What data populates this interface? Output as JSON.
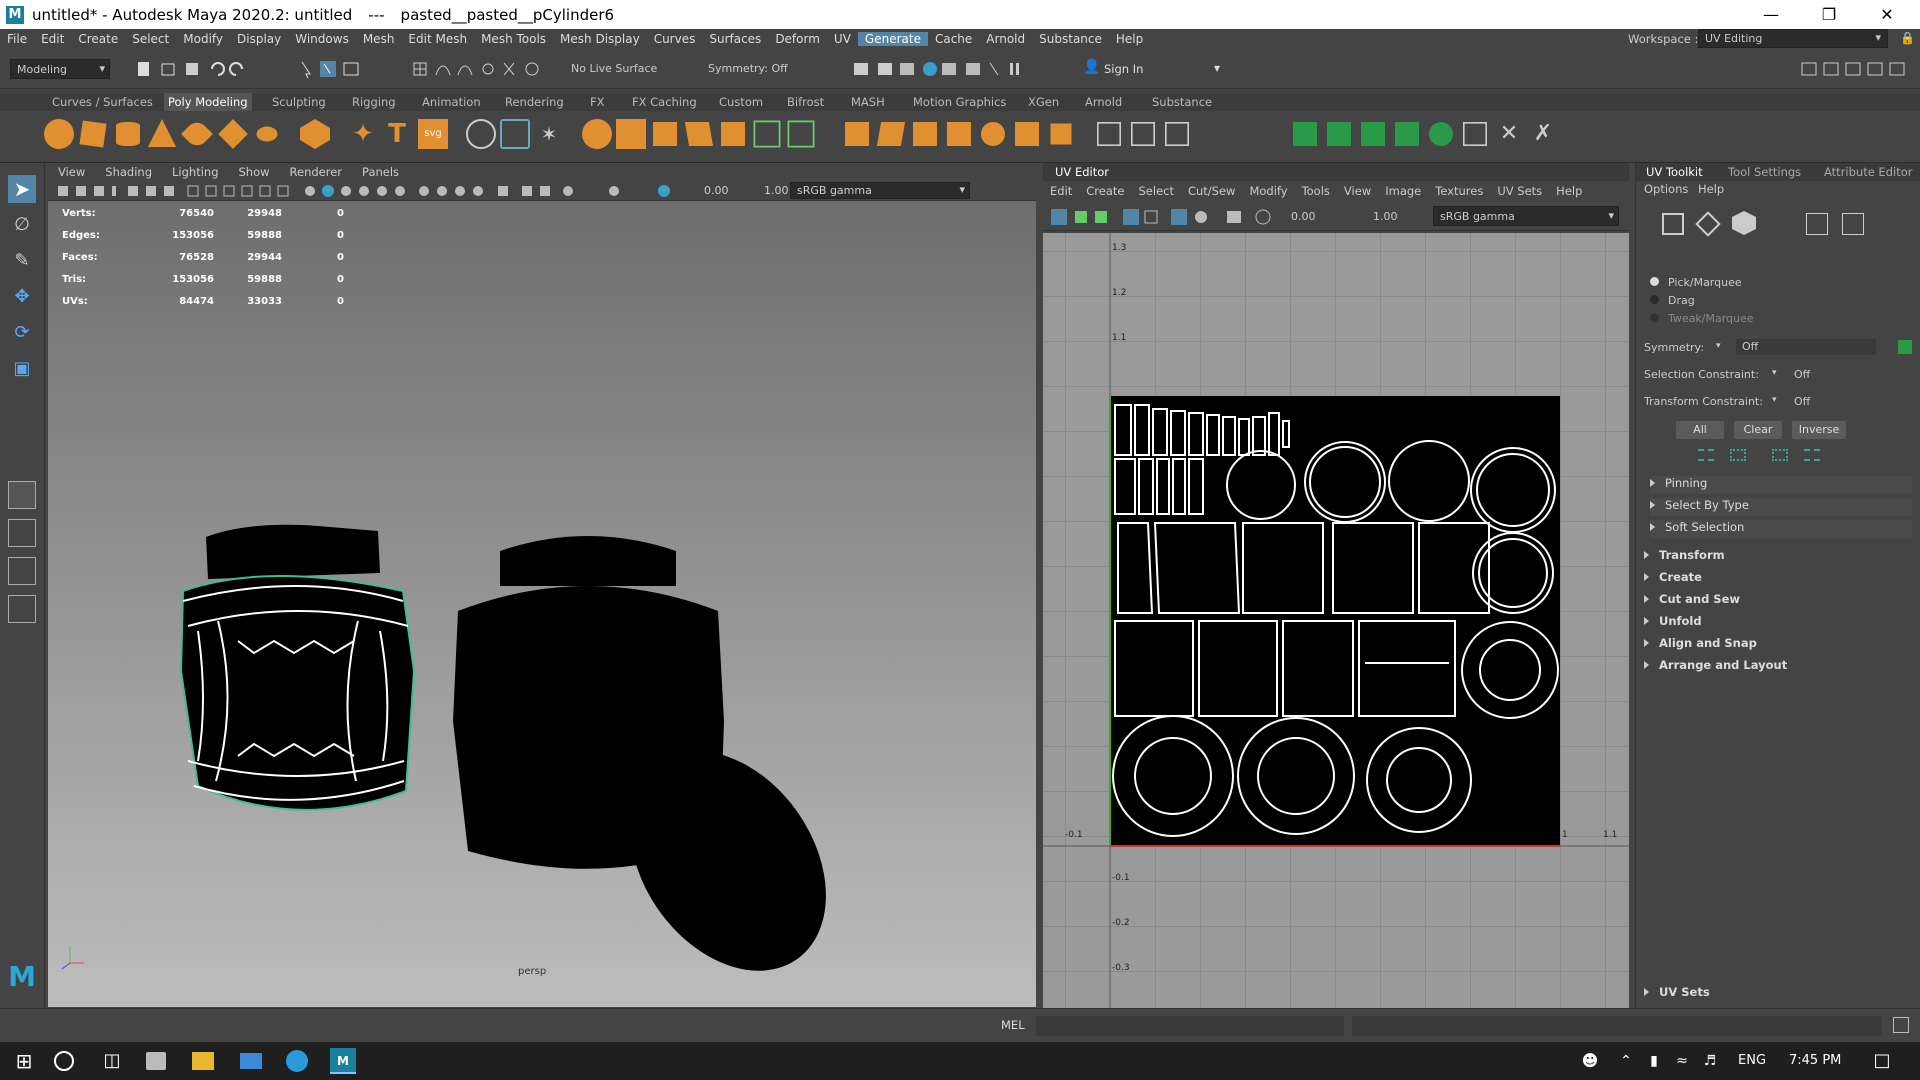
{
  "title": {
    "app_title": "untitled* - Autodesk Maya 2020.2: untitled",
    "separator": "---",
    "object_name": "pasted__pasted__pCylinder6",
    "minimize_icon": "minimize-icon",
    "restore_icon": "restore-icon",
    "close_icon": "close-icon"
  },
  "menubar": {
    "items": [
      "File",
      "Edit",
      "Create",
      "Select",
      "Modify",
      "Display",
      "Windows",
      "Mesh",
      "Edit Mesh",
      "Mesh Tools",
      "Mesh Display",
      "Curves",
      "Surfaces",
      "Deform",
      "UV",
      "Generate",
      "Cache",
      "Arnold",
      "Substance",
      "Help"
    ],
    "active": "Generate",
    "workspace_label": "Workspace :",
    "workspace_value": "UV Editing"
  },
  "statusline": {
    "menuset": "Modeling",
    "live_surface": "No Live Surface",
    "symmetry": "Symmetry: Off",
    "sign_in": "Sign In"
  },
  "shelf": {
    "tabs": [
      "Curves / Surfaces",
      "Poly Modeling",
      "Sculpting",
      "Rigging",
      "Animation",
      "Rendering",
      "FX",
      "FX Caching",
      "Custom",
      "Bifrost",
      "MASH",
      "Motion Graphics",
      "XGen",
      "Arnold",
      "Substance"
    ],
    "active": "Poly Modeling",
    "svg_label": "svg"
  },
  "viewport": {
    "menus": [
      "View",
      "Shading",
      "Lighting",
      "Show",
      "Renderer",
      "Panels"
    ],
    "exposure": "0.00",
    "gamma": "1.00",
    "colorspace": "sRGB gamma",
    "camera": "persp",
    "hud": [
      {
        "label": "Verts:",
        "a": "76540",
        "b": "29948",
        "c": "0"
      },
      {
        "label": "Edges:",
        "a": "153056",
        "b": "59888",
        "c": "0"
      },
      {
        "label": "Faces:",
        "a": "76528",
        "b": "29944",
        "c": "0"
      },
      {
        "label": "Tris:",
        "a": "153056",
        "b": "59888",
        "c": "0"
      },
      {
        "label": "UVs:",
        "a": "84474",
        "b": "33033",
        "c": "0"
      }
    ]
  },
  "uv_editor": {
    "tab": "UV Editor",
    "menus": [
      "Edit",
      "Create",
      "Select",
      "Cut/Sew",
      "Modify",
      "Tools",
      "View",
      "Image",
      "Textures",
      "UV Sets",
      "Help"
    ],
    "exposure": "0.00",
    "gamma": "1.00",
    "colorspace": "sRGB gamma",
    "v_labels": [
      "1.3",
      "1.2",
      "1.1",
      "-0.1",
      "-0.2",
      "-0.3"
    ],
    "u_labels": [
      "-0.1",
      "1",
      "1.1"
    ]
  },
  "uv_toolkit": {
    "tabs": [
      "UV Toolkit",
      "Tool Settings",
      "Attribute Editor"
    ],
    "active_tab": "UV Toolkit",
    "menus": [
      "Options",
      "Help"
    ],
    "pick_modes": [
      "Pick/Marquee",
      "Drag",
      "Tweak/Marquee"
    ],
    "symmetry_label": "Symmetry:",
    "symmetry_value": "Off",
    "selection_constraint_label": "Selection Constraint:",
    "selection_constraint_value": "Off",
    "transform_constraint_label": "Transform Constraint:",
    "transform_constraint_value": "Off",
    "buttons": [
      "All",
      "Clear",
      "Inverse"
    ],
    "sub_sections": [
      "Pinning",
      "Select By Type",
      "Soft Selection"
    ],
    "sections": [
      "Transform",
      "Create",
      "Cut and Sew",
      "Unfold",
      "Align and Snap",
      "Arrange and Layout"
    ],
    "uv_sets": "UV Sets"
  },
  "cmdline": {
    "lang": "MEL"
  },
  "taskbar": {
    "lang": "ENG",
    "time": "7:45 PM"
  }
}
